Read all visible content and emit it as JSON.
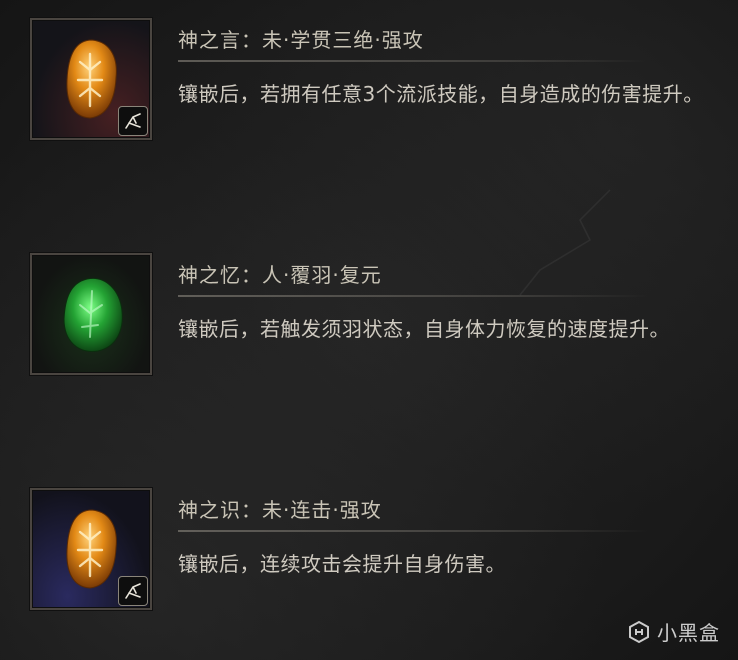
{
  "entries": [
    {
      "title": "神之言：未·学贯三绝·强攻",
      "description": "镶嵌后，若拥有任意3个流派技能，自身造成的伤害提升。",
      "gem_color": "amber",
      "badge_icon": "attack-stance-icon"
    },
    {
      "title": "神之忆：人·覆羽·复元",
      "description": "镶嵌后，若触发须羽状态，自身体力恢复的速度提升。",
      "gem_color": "green",
      "badge_icon": null
    },
    {
      "title": "神之识：未·连击·强攻",
      "description": "镶嵌后，连续攻击会提升自身伤害。",
      "gem_color": "amber",
      "badge_icon": "attack-stance-icon"
    }
  ],
  "watermark": {
    "text": "小黑盒",
    "icon": "heybox-logo-icon"
  },
  "colors": {
    "amber_gem": "#e08a1a",
    "green_gem": "#2fae3a",
    "title_text": "#c9c4b6",
    "body_text": "#cfcac0"
  }
}
